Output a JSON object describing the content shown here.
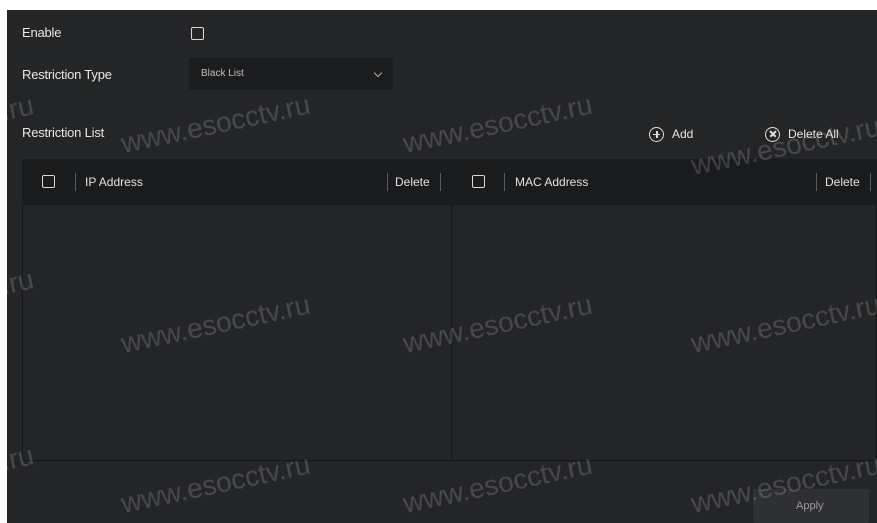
{
  "form": {
    "enable_label": "Enable",
    "enable_checked": false,
    "restriction_type_label": "Restriction Type",
    "restriction_type_value": "Black List",
    "restriction_list_label": "Restriction List"
  },
  "actions": {
    "add_label": "Add",
    "delete_all_label": "Delete All"
  },
  "ip_table": {
    "col_address": "IP Address",
    "col_delete": "Delete",
    "rows": []
  },
  "mac_table": {
    "col_address": "MAC Address",
    "col_delete": "Delete",
    "rows": []
  },
  "footer": {
    "apply_label": "Apply"
  },
  "watermark": {
    "text": "www.esocctv.ru",
    "fragment": "v.ru"
  }
}
